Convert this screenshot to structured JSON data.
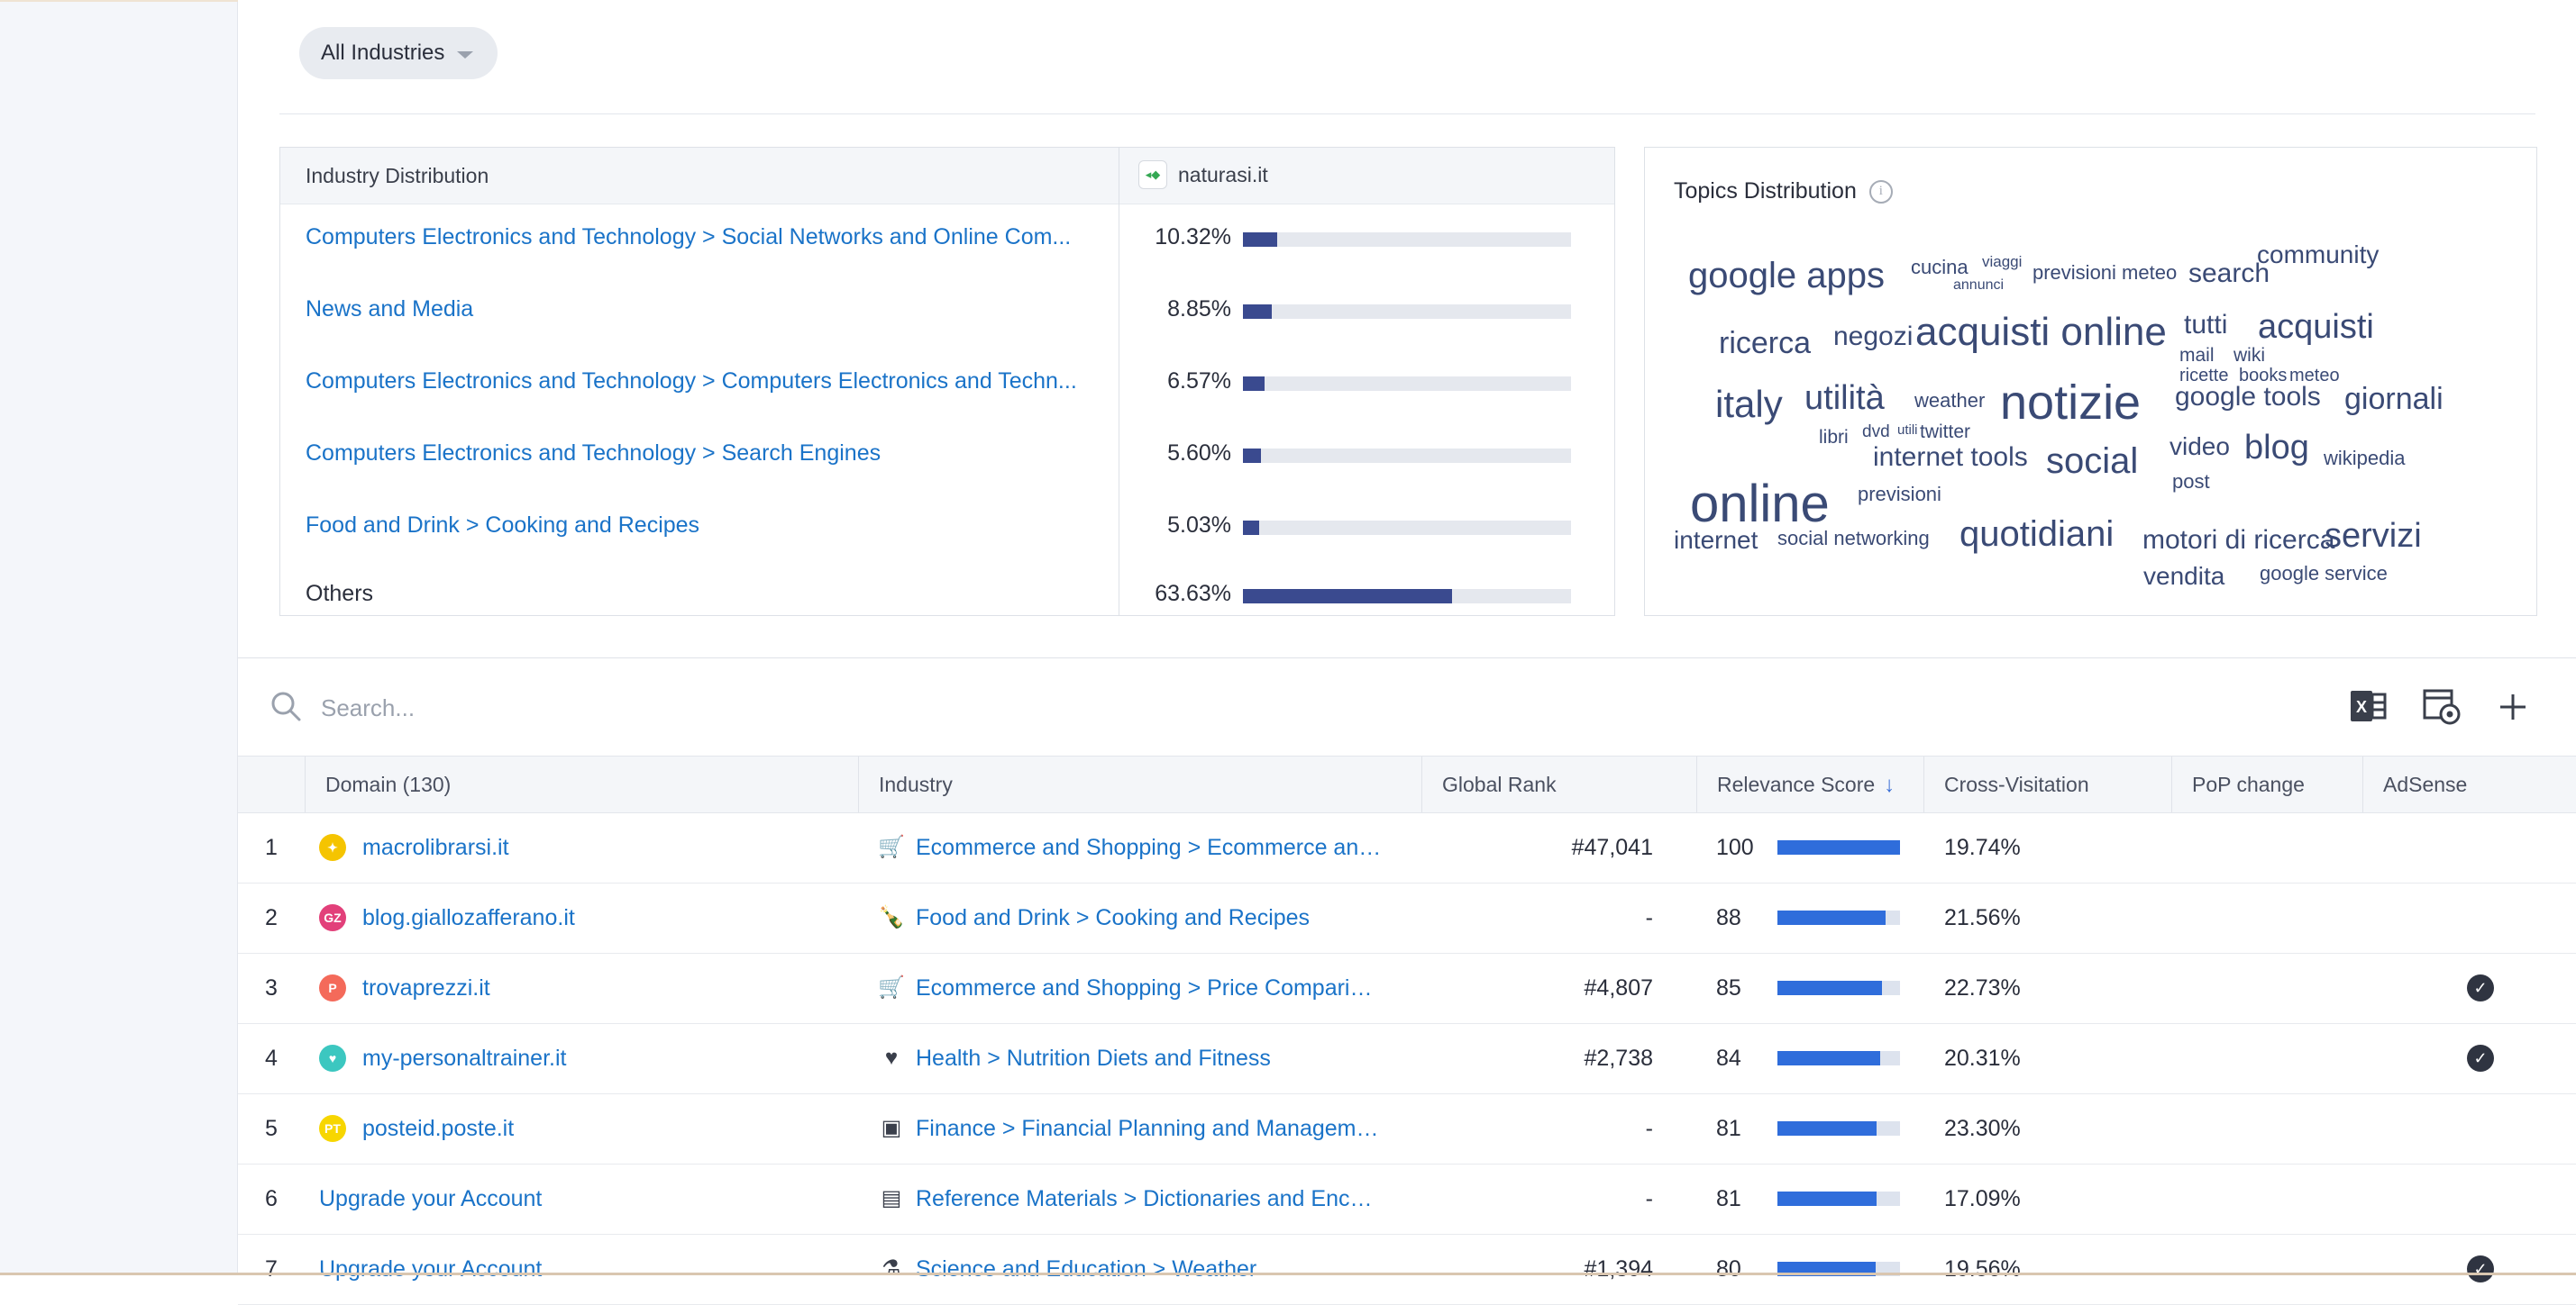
{
  "filters": {
    "industry_selected": "All Industries"
  },
  "industry_distribution": {
    "header_label": "Industry Distribution",
    "site": "naturasi.it",
    "site_favicon": "leaf-icon",
    "rows": [
      {
        "label": "Computers Electronics and Technology > Social Networks and Online Com...",
        "pct": "10.32%",
        "value": 10.32
      },
      {
        "label": "News and Media",
        "pct": "8.85%",
        "value": 8.85
      },
      {
        "label": "Computers Electronics and Technology > Computers Electronics and Techn...",
        "pct": "6.57%",
        "value": 6.57
      },
      {
        "label": "Computers Electronics and Technology > Search Engines",
        "pct": "5.60%",
        "value": 5.6
      },
      {
        "label": "Food and Drink > Cooking and Recipes",
        "pct": "5.03%",
        "value": 5.03
      },
      {
        "label": "Others",
        "pct": "63.63%",
        "value": 63.63
      }
    ],
    "bar_color": "#3a4a8f"
  },
  "topics": {
    "title": "Topics Distribution",
    "words": [
      "google apps",
      "cucina",
      "viaggi",
      "annunci",
      "previsioni meteo",
      "search",
      "community",
      "ricerca",
      "negozi",
      "acquisti online",
      "tutti",
      "acquisti",
      "mail",
      "wiki",
      "ricette",
      "books",
      "meteo",
      "italy",
      "utilità",
      "weather",
      "notizie",
      "google tools",
      "giornali",
      "libri",
      "dvd",
      "utili",
      "twitter",
      "internet tools",
      "social",
      "video",
      "blog",
      "wikipedia",
      "online",
      "previsioni",
      "post",
      "internet",
      "social networking",
      "quotidiani",
      "motori di ricerca",
      "servizi",
      "vendita",
      "google service"
    ]
  },
  "search": {
    "placeholder": "Search..."
  },
  "toolbar": {
    "icons": [
      "excel-export-icon",
      "table-settings-icon",
      "add-icon"
    ]
  },
  "table": {
    "headers": {
      "domain": "Domain (130)",
      "industry": "Industry",
      "global_rank": "Global Rank",
      "relevance": "Relevance Score",
      "cross": "Cross-Visitation",
      "pop": "PoP change",
      "adsense": "AdSense"
    },
    "sort_column": "relevance",
    "rows": [
      {
        "num": "1",
        "domain": "macrolibrarsi.it",
        "fav_color": "#f5c400",
        "fav_glyph": "✦",
        "ind_icon": "shopping-cart-icon",
        "ind_glyph": "🛒",
        "industry": "Ecommerce and Shopping > Ecommerce and...",
        "rank": "#47,041",
        "rel": "100",
        "rel_val": 100,
        "cross": "19.74%",
        "pop": "-",
        "adsense": false
      },
      {
        "num": "2",
        "domain": "blog.giallozafferano.it",
        "fav_color": "#e2407a",
        "fav_glyph": "GZ",
        "ind_icon": "bottle-icon",
        "ind_glyph": "🍾",
        "industry": "Food and Drink > Cooking and Recipes",
        "rank": "-",
        "rel": "88",
        "rel_val": 88,
        "cross": "21.56%",
        "pop": "-",
        "adsense": false
      },
      {
        "num": "3",
        "domain": "trovaprezzi.it",
        "fav_color": "#f46a5a",
        "fav_glyph": "P",
        "ind_icon": "shopping-cart-icon",
        "ind_glyph": "🛒",
        "industry": "Ecommerce and Shopping > Price Comparison",
        "rank": "#4,807",
        "rel": "85",
        "rel_val": 85,
        "cross": "22.73%",
        "pop": "-",
        "adsense": true
      },
      {
        "num": "4",
        "domain": "my-personaltrainer.it",
        "fav_color": "#3cc7c0",
        "fav_glyph": "♥",
        "ind_icon": "heartbeat-icon",
        "ind_glyph": "♥",
        "industry": "Health > Nutrition Diets and Fitness",
        "rank": "#2,738",
        "rel": "84",
        "rel_val": 84,
        "cross": "20.31%",
        "pop": "-",
        "adsense": true
      },
      {
        "num": "5",
        "domain": "posteid.poste.it",
        "fav_color": "#f7d600",
        "fav_glyph": "PT",
        "ind_icon": "wallet-icon",
        "ind_glyph": "▣",
        "industry": "Finance > Financial Planning and Manageme...",
        "rank": "-",
        "rel": "81",
        "rel_val": 81,
        "cross": "23.30%",
        "pop": "-",
        "adsense": false
      },
      {
        "num": "6",
        "domain": "Upgrade your Account",
        "fav_color": "",
        "fav_glyph": "",
        "ind_icon": "book-icon",
        "ind_glyph": "▤",
        "industry": "Reference Materials > Dictionaries and Encyc...",
        "rank": "-",
        "rel": "81",
        "rel_val": 81,
        "cross": "17.09%",
        "pop": "-",
        "adsense": false
      },
      {
        "num": "7",
        "domain": "Upgrade your Account",
        "fav_color": "",
        "fav_glyph": "",
        "ind_icon": "microscope-icon",
        "ind_glyph": "⚗",
        "industry": "Science and Education > Weather",
        "rank": "#1,394",
        "rel": "80",
        "rel_val": 80,
        "cross": "19.56%",
        "pop": "-",
        "adsense": true
      }
    ]
  },
  "colors": {
    "link": "#1a73c8",
    "relevance_bar": "#2f6ddb",
    "distribution_bar": "#3a4a8f",
    "word_cloud": "#3a4a75"
  }
}
